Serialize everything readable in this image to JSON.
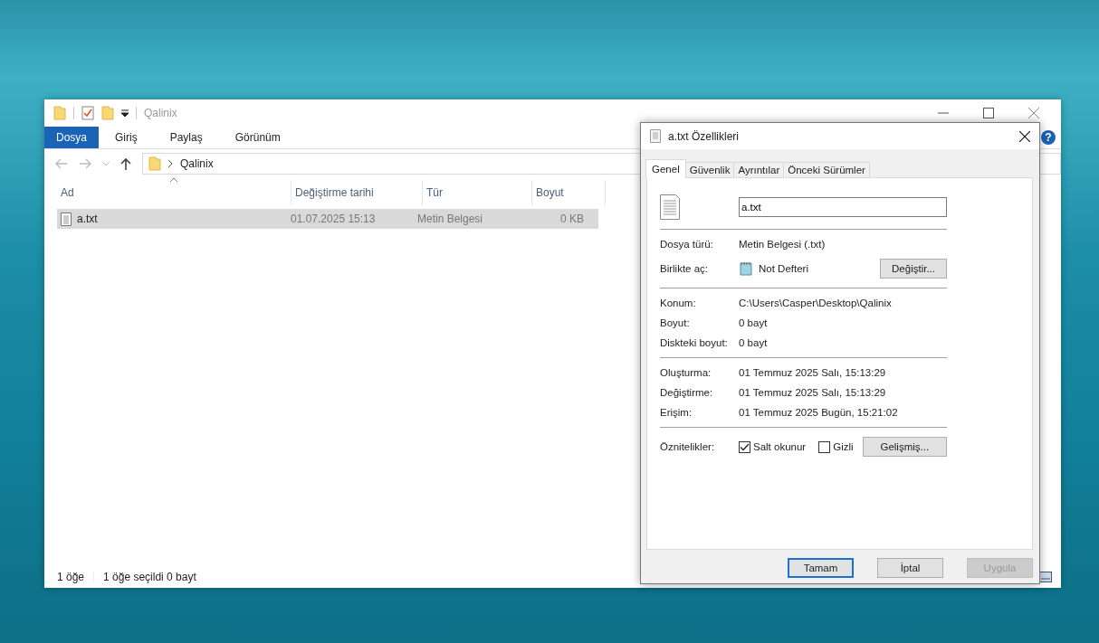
{
  "explorer": {
    "title": "Qalinix",
    "ribbon_tabs": [
      {
        "label": "Dosya",
        "selected": true
      },
      {
        "label": "Giriş",
        "selected": false
      },
      {
        "label": "Paylaş",
        "selected": false
      },
      {
        "label": "Görünüm",
        "selected": false
      }
    ],
    "address": {
      "path": "Qalinix"
    },
    "help_glyph": "?",
    "columns": [
      {
        "label": "Ad",
        "sorted": true
      },
      {
        "label": "Değiştirme tarihi",
        "sorted": false
      },
      {
        "label": "Tür",
        "sorted": false
      },
      {
        "label": "Boyut",
        "sorted": false
      }
    ],
    "files": [
      {
        "name": "a.txt",
        "modified": "01.07.2025 15:13",
        "type": "Metin Belgesi",
        "size": "0 KB",
        "selected": true
      }
    ],
    "status_bar": {
      "count": "1 öğe",
      "selection": "1 öğe seçildi  0 bayt"
    }
  },
  "dialog": {
    "title": "a.txt Özellikleri",
    "tabs": [
      {
        "label": "Genel",
        "selected": true
      },
      {
        "label": "Güvenlik",
        "selected": false
      },
      {
        "label": "Ayrıntılar",
        "selected": false
      },
      {
        "label": "Önceki Sürümler",
        "selected": false
      }
    ],
    "file_name": "a.txt",
    "groups": [
      [
        {
          "label": "Dosya türü:",
          "value": "Metin Belgesi (.txt)",
          "kind": "text"
        },
        {
          "label": "Birlikte aç:",
          "value": "Not Defteri",
          "kind": "app",
          "button": "Değiştir..."
        }
      ],
      [
        {
          "label": "Konum:",
          "value": "C:\\Users\\Casper\\Desktop\\Qalinix",
          "kind": "text"
        },
        {
          "label": "Boyut:",
          "value": "0 bayt",
          "kind": "text"
        },
        {
          "label": "Diskteki boyut:",
          "value": "0 bayt",
          "kind": "text"
        }
      ],
      [
        {
          "label": "Oluşturma:",
          "value": "01 Temmuz 2025 Salı, 15:13:29",
          "kind": "text"
        },
        {
          "label": "Değiştirme:",
          "value": "01 Temmuz 2025 Salı, 15:13:29",
          "kind": "text"
        },
        {
          "label": "Erişim:",
          "value": "01 Temmuz 2025 Bugün, 15:21:02",
          "kind": "text"
        }
      ]
    ],
    "attributes_label": "Öznitelikler:",
    "attributes": [
      {
        "label": "Salt okunur",
        "checked": true
      },
      {
        "label": "Gizli",
        "checked": false
      }
    ],
    "advanced_button": "Gelişmiş...",
    "buttons": [
      {
        "label": "Tamam",
        "kind": "default"
      },
      {
        "label": "İptal",
        "kind": "normal"
      },
      {
        "label": "Uygula",
        "kind": "disabled"
      }
    ]
  }
}
